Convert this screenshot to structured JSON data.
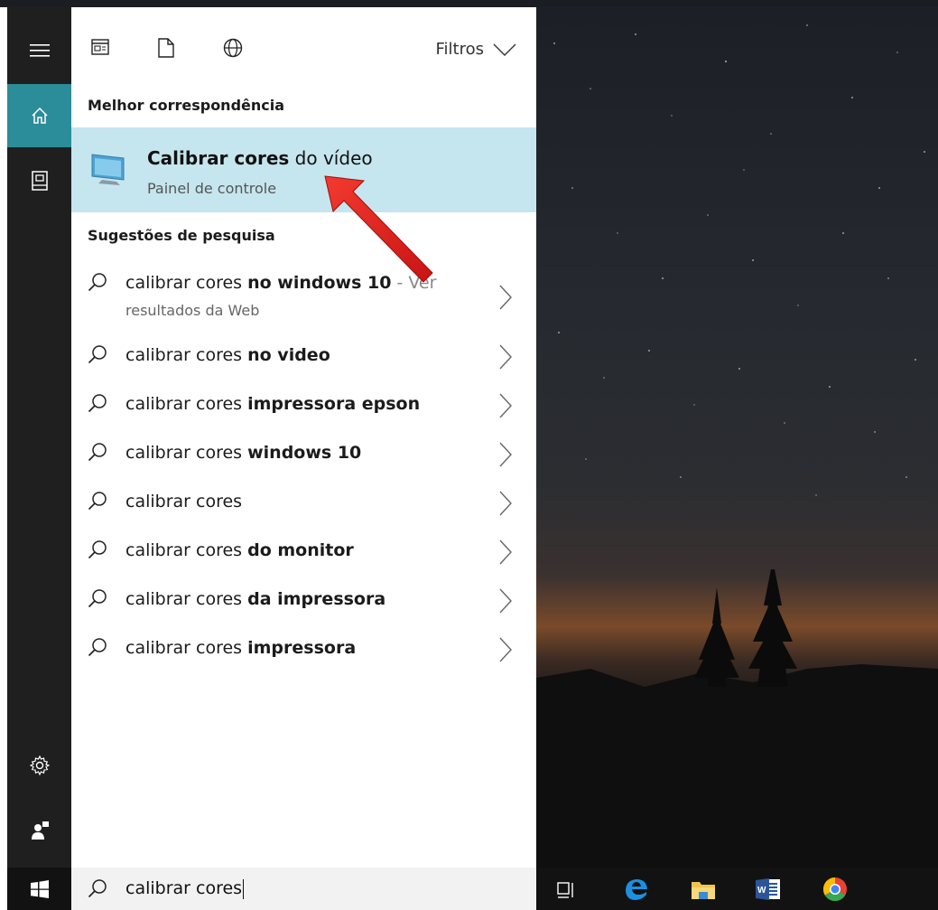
{
  "rail": {
    "items": [
      {
        "icon": "hamburger-menu-icon"
      },
      {
        "icon": "home-icon",
        "active": true
      },
      {
        "icon": "notebook-icon"
      }
    ],
    "bottom_items": [
      {
        "icon": "gear-icon"
      },
      {
        "icon": "feedback-person-icon"
      }
    ]
  },
  "topbar": {
    "filters_label": "Filtros"
  },
  "best_match": {
    "heading": "Melhor correspondência",
    "title_bold": "Calibrar cores",
    "title_rest": " do vídeo",
    "subtitle": "Painel de controle",
    "icon": "monitor-icon"
  },
  "suggestions": {
    "heading": "Sugestões de pesquisa",
    "items": [
      {
        "prefix": "calibrar cores ",
        "bold": "no windows 10",
        "suffix": " - Ver",
        "line2": "resultados da Web"
      },
      {
        "prefix": "calibrar cores ",
        "bold": "no video"
      },
      {
        "prefix": "calibrar cores ",
        "bold": "impressora epson"
      },
      {
        "prefix": "calibrar cores ",
        "bold": "windows 10"
      },
      {
        "prefix": "calibrar cores",
        "bold": ""
      },
      {
        "prefix": "calibrar cores ",
        "bold": "do monitor"
      },
      {
        "prefix": "calibrar cores ",
        "bold": "da impressora"
      },
      {
        "prefix": "calibrar cores ",
        "bold": "impressora"
      }
    ]
  },
  "search": {
    "value": "calibrar cores"
  },
  "taskbar": {
    "apps": [
      "task-view-icon",
      "edge-icon",
      "file-explorer-icon",
      "word-icon",
      "chrome-icon"
    ]
  },
  "colors": {
    "accent": "#2b8d99",
    "best_match_bg": "#c5e6ee",
    "rail_bg": "#1f1f1f",
    "arrow": "#e11b1b"
  }
}
